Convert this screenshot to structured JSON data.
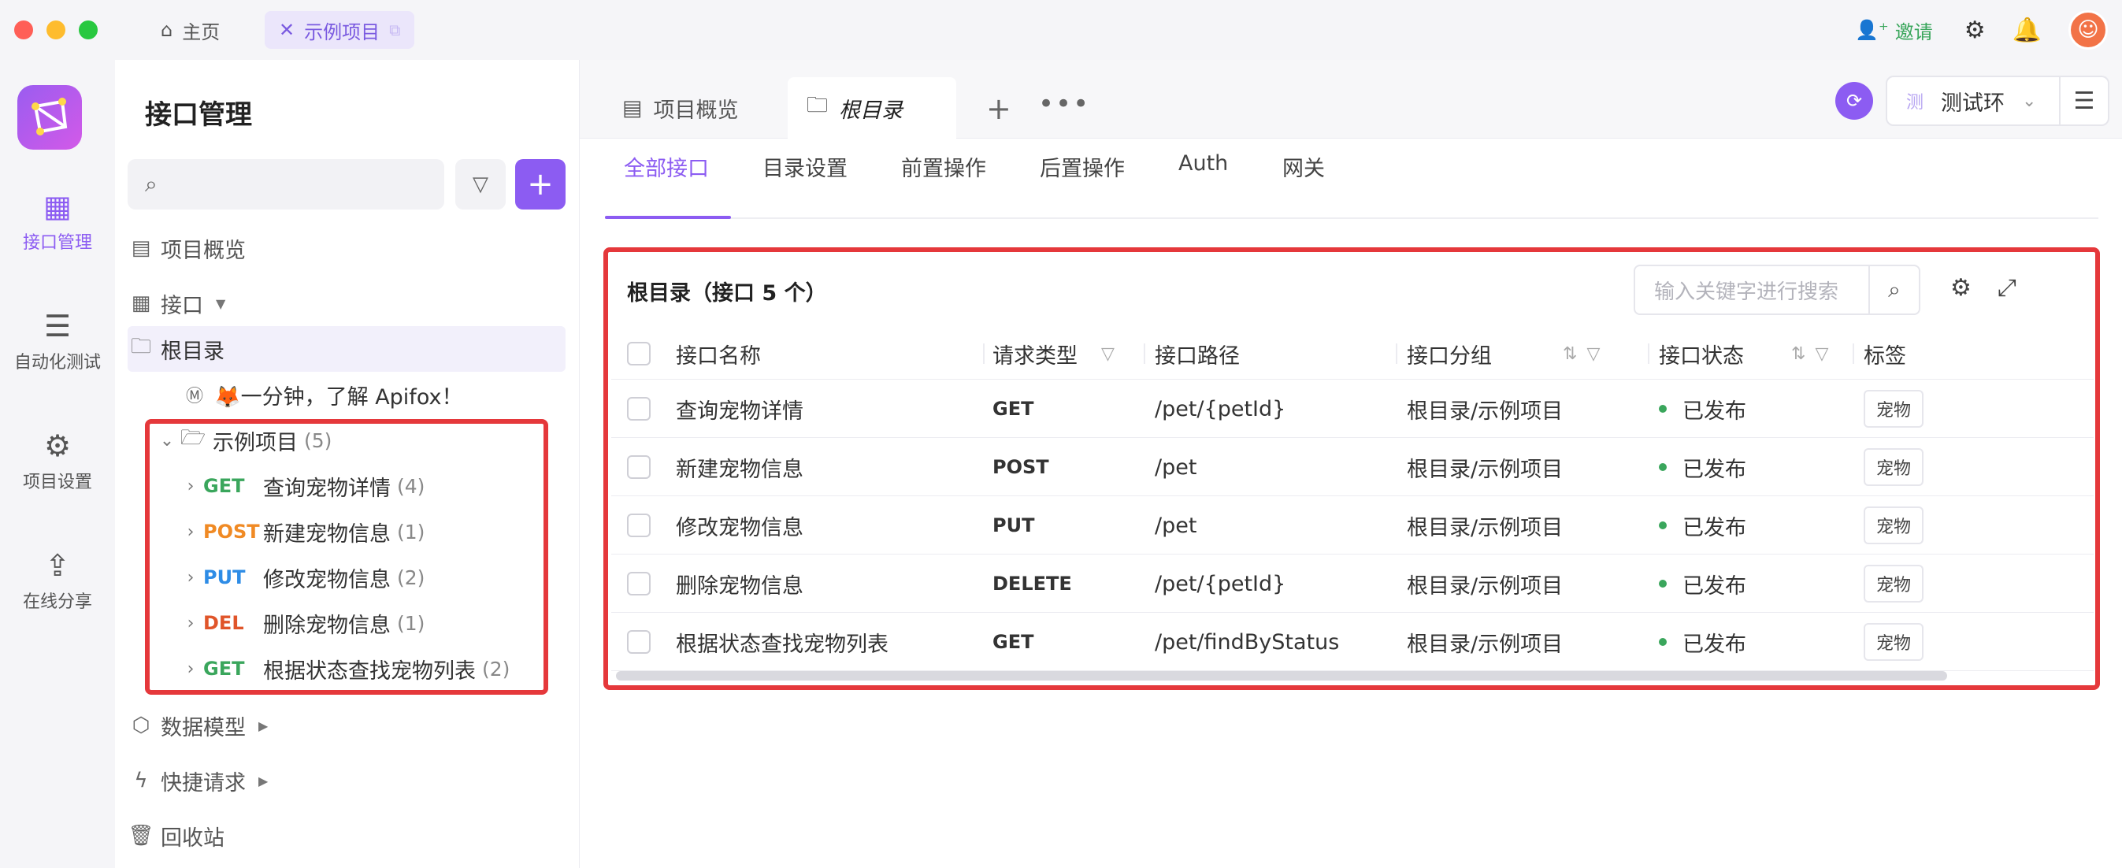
{
  "titlebar": {
    "tabs": [
      {
        "label": "主页",
        "icon": "home-icon"
      },
      {
        "label": "示例项目",
        "icon": "close-icon"
      }
    ],
    "invite_label": "邀请",
    "icons": [
      "gear-icon",
      "bell-icon",
      "avatar"
    ]
  },
  "rail": {
    "items": [
      {
        "label": "接口管理",
        "icon": "api-icon",
        "active": true
      },
      {
        "label": "自动化测试",
        "icon": "automation-icon"
      },
      {
        "label": "项目设置",
        "icon": "settings-icon"
      },
      {
        "label": "在线分享",
        "icon": "share-icon"
      }
    ]
  },
  "sidebar": {
    "title": "接口管理",
    "tree": {
      "overview": "项目概览",
      "api": "接口",
      "root": "根目录",
      "intro": "🦊一分钟，了解 Apifox！",
      "folder": {
        "label": "示例项目",
        "count": "(5)"
      },
      "items": [
        {
          "method": "GET",
          "label": "查询宠物详情",
          "count": "(4)"
        },
        {
          "method": "POST",
          "label": "新建宠物信息",
          "count": "(1)"
        },
        {
          "method": "PUT",
          "label": "修改宠物信息",
          "count": "(2)"
        },
        {
          "method": "DEL",
          "label": "删除宠物信息",
          "count": "(1)"
        },
        {
          "method": "GET",
          "label": "根据状态查找宠物列表",
          "count": "(2)"
        }
      ],
      "models": "数据模型",
      "quick": "快捷请求",
      "trash": "回收站"
    }
  },
  "main": {
    "tabs": [
      {
        "label": "项目概览"
      },
      {
        "label": "根目录"
      }
    ],
    "env": {
      "badge": "测",
      "label": "测试环"
    },
    "subtabs": [
      "全部接口",
      "目录设置",
      "前置操作",
      "后置操作",
      "Auth",
      "网关"
    ],
    "panel": {
      "title": "根目录（接口 5 个）",
      "search_placeholder": "输入关键字进行搜索",
      "columns": [
        "接口名称",
        "请求类型",
        "接口路径",
        "接口分组",
        "接口状态",
        "标签"
      ],
      "rows": [
        {
          "name": "查询宠物详情",
          "method": "GET",
          "path": "/pet/{petId}",
          "group": "根目录/示例项目",
          "status": "已发布",
          "tag": "宠物"
        },
        {
          "name": "新建宠物信息",
          "method": "POST",
          "path": "/pet",
          "group": "根目录/示例项目",
          "status": "已发布",
          "tag": "宠物"
        },
        {
          "name": "修改宠物信息",
          "method": "PUT",
          "path": "/pet",
          "group": "根目录/示例项目",
          "status": "已发布",
          "tag": "宠物"
        },
        {
          "name": "删除宠物信息",
          "method": "DELETE",
          "path": "/pet/{petId}",
          "group": "根目录/示例项目",
          "status": "已发布",
          "tag": "宠物"
        },
        {
          "name": "根据状态查找宠物列表",
          "method": "GET",
          "path": "/pet/findByStatus",
          "group": "根目录/示例项目",
          "status": "已发布",
          "tag": "宠物"
        }
      ]
    }
  },
  "colors": {
    "accent": "#8c5cf2",
    "get": "#3aa65c",
    "post": "#f08a24",
    "put": "#2e8ce6",
    "delete": "#e0552a",
    "highlight_box": "#e5383b"
  }
}
